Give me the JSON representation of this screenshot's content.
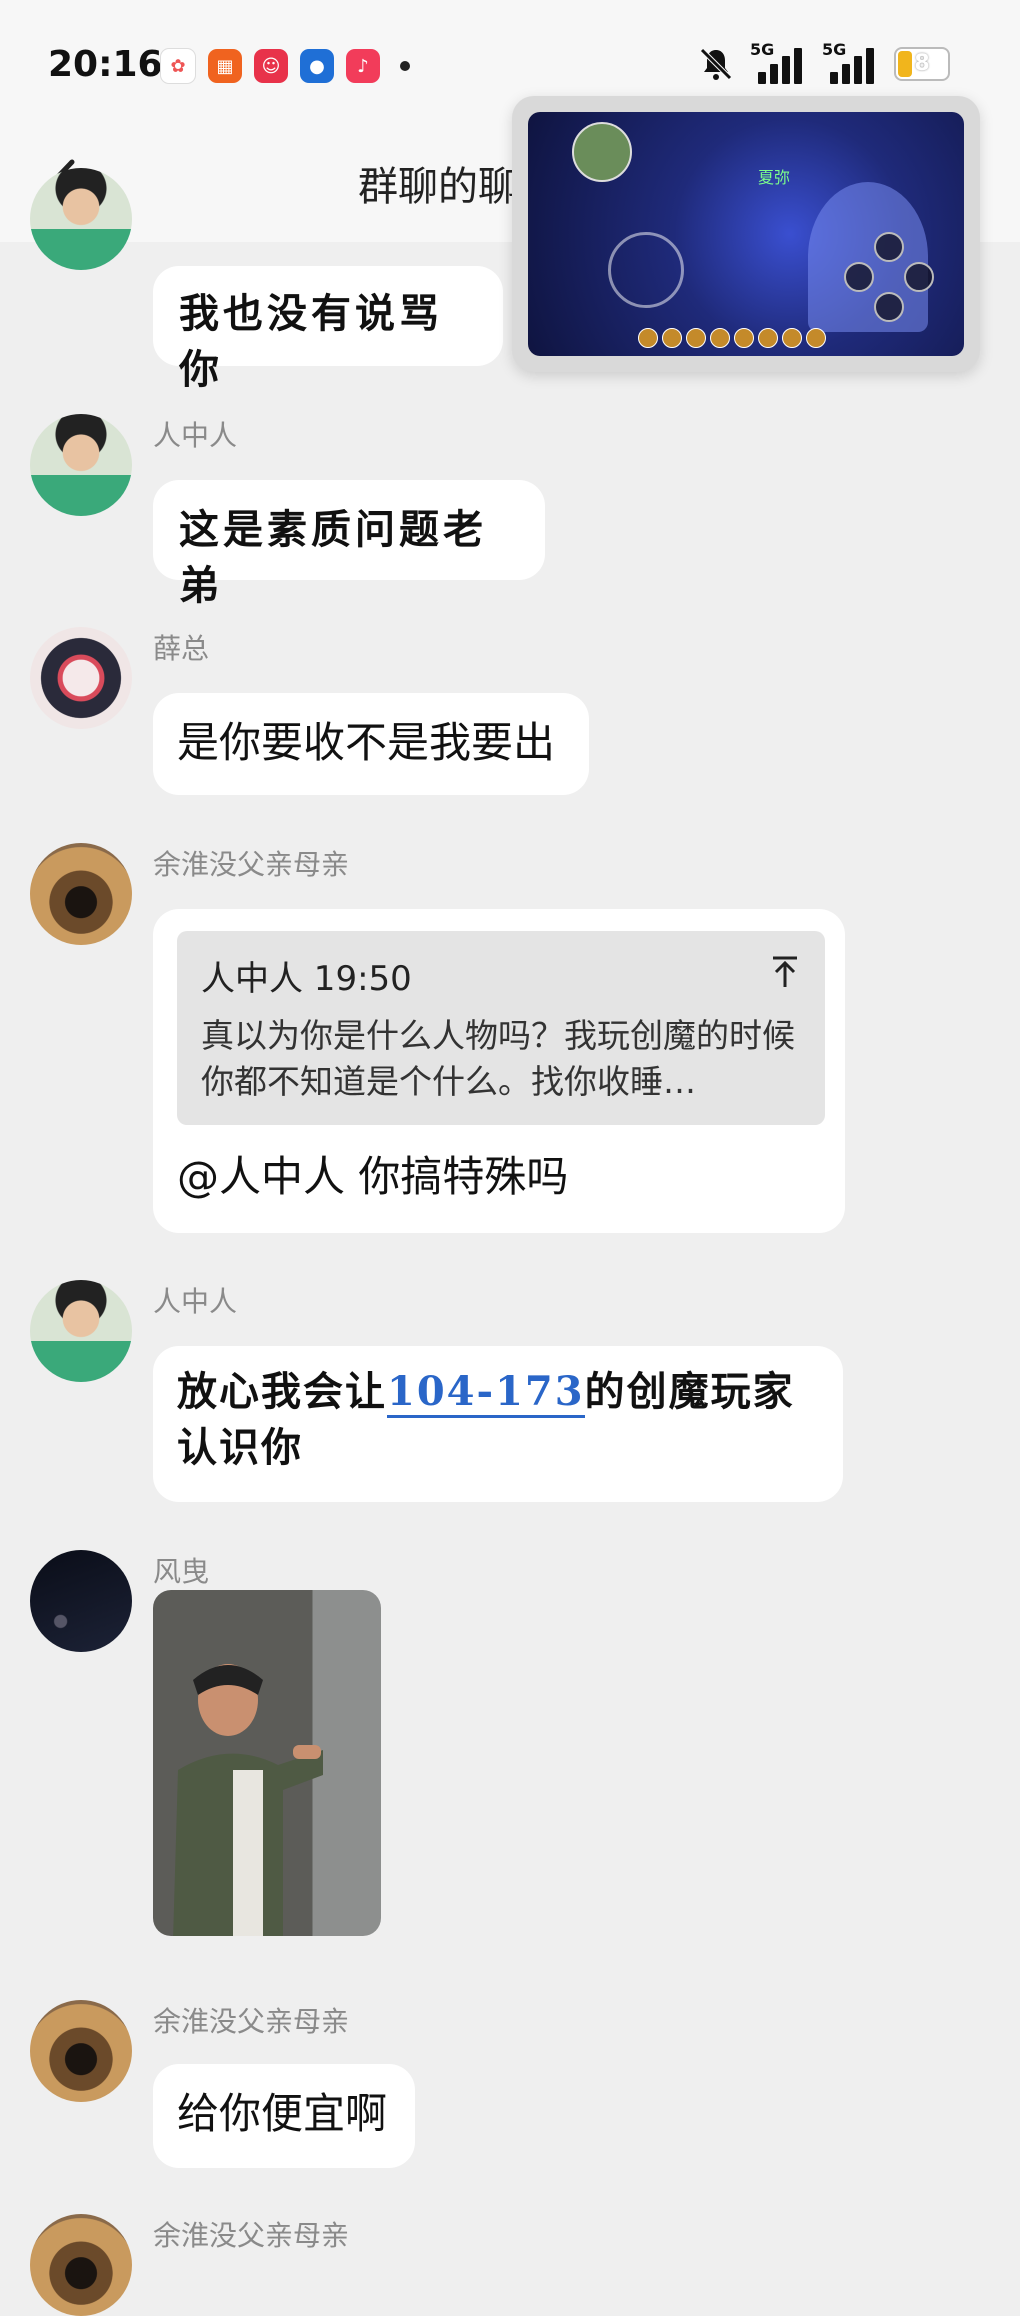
{
  "status_bar": {
    "time": "20:16",
    "signal_1": "5G",
    "signal_2": "5G",
    "battery": "8",
    "app_icons": [
      "photos-icon",
      "grid-app-icon",
      "618-app-icon",
      "account-app-icon",
      "music-icon"
    ]
  },
  "header": {
    "title": "群聊的聊"
  },
  "pip": {
    "game_title": "夏弥"
  },
  "messages": [
    {
      "sender": "",
      "text": "我也没有说骂你"
    },
    {
      "sender": "人中人",
      "text": "这是素质问题老弟"
    },
    {
      "sender": "薛总",
      "text": "是你要收不是我要出"
    },
    {
      "sender": "余淮没父亲母亲",
      "quote_head": "人中人 19:50",
      "quote_body": "真以为你是什么人物吗？我玩创魔的时候你都不知道是个什么。找你收睡…",
      "text": "@人中人 你搞特殊吗"
    },
    {
      "sender": "人中人",
      "text_before": "放心我会让",
      "link": "104-173",
      "text_after": "的创魔玩家认识你"
    },
    {
      "sender": "风曳"
    },
    {
      "sender": "余淮没父亲母亲",
      "text": "给你便宜啊"
    },
    {
      "sender": "余淮没父亲母亲"
    }
  ],
  "colors": {
    "background": "#efefef",
    "bubble": "#ffffff",
    "link": "#2a66c8",
    "sender": "#8a8a8a"
  }
}
